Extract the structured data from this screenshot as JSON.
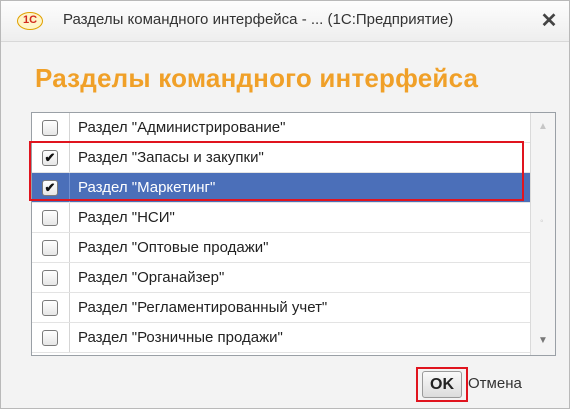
{
  "window": {
    "title": "Разделы командного интерфейса - ...  (1С:Предприятие)",
    "logo_text": "1С",
    "close_glyph": "✕"
  },
  "heading": "Разделы командного интерфейса",
  "rows": [
    {
      "label": "Раздел \"Администрирование\"",
      "checked": false,
      "selected": false
    },
    {
      "label": "Раздел \"Запасы и закупки\"",
      "checked": true,
      "selected": false
    },
    {
      "label": "Раздел \"Маркетинг\"",
      "checked": true,
      "selected": true
    },
    {
      "label": "Раздел \"НСИ\"",
      "checked": false,
      "selected": false
    },
    {
      "label": "Раздел \"Оптовые продажи\"",
      "checked": false,
      "selected": false
    },
    {
      "label": "Раздел \"Органайзер\"",
      "checked": false,
      "selected": false
    },
    {
      "label": "Раздел \"Регламентированный учет\"",
      "checked": false,
      "selected": false
    },
    {
      "label": "Раздел \"Розничные продажи\"",
      "checked": false,
      "selected": false
    }
  ],
  "buttons": {
    "ok": "OK",
    "cancel": "Отмена"
  },
  "colors": {
    "heading": "#f0a028",
    "selection": "#4b6fb9",
    "highlight_frame": "#e0141e"
  }
}
